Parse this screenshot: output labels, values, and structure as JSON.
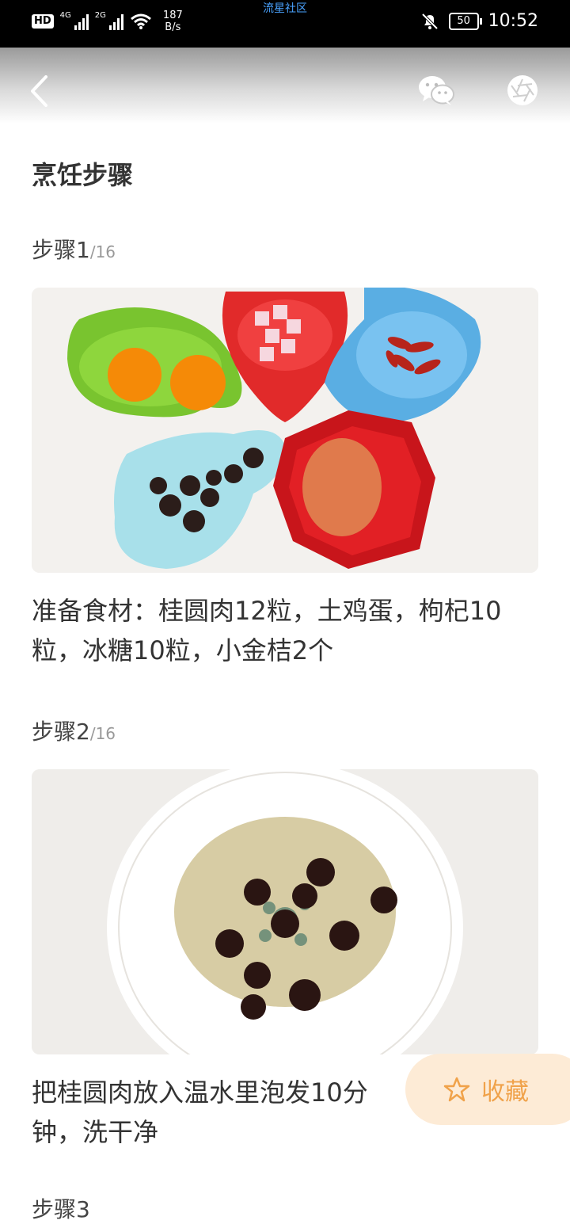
{
  "status_bar": {
    "hd": "HD",
    "sim1_net": "4G",
    "sim2_net": "2G",
    "speed_value": "187",
    "speed_unit": "B/s",
    "carrier_overlay": "流星社区",
    "battery": "50",
    "time": "10:52"
  },
  "header": {
    "back_icon": "chevron-left-icon",
    "share_wechat_icon": "wechat-icon",
    "share_moments_icon": "moments-icon"
  },
  "section": {
    "title": "烹饪步骤"
  },
  "steps": [
    {
      "label": "步骤1",
      "total": "/16",
      "text": "准备食材：桂圆肉12粒，土鸡蛋，枸杞10粒，冰糖10粒，小金桔2个"
    },
    {
      "label": "步骤2",
      "total": "/16",
      "text": "把桂圆肉放入温水里泡发10分钟，洗干净"
    },
    {
      "label": "步骤3"
    }
  ],
  "favorite": {
    "label": "收藏",
    "icon": "star-icon"
  },
  "colors": {
    "accent": "#f0a24a",
    "fav_bg": "#fdebd6"
  }
}
